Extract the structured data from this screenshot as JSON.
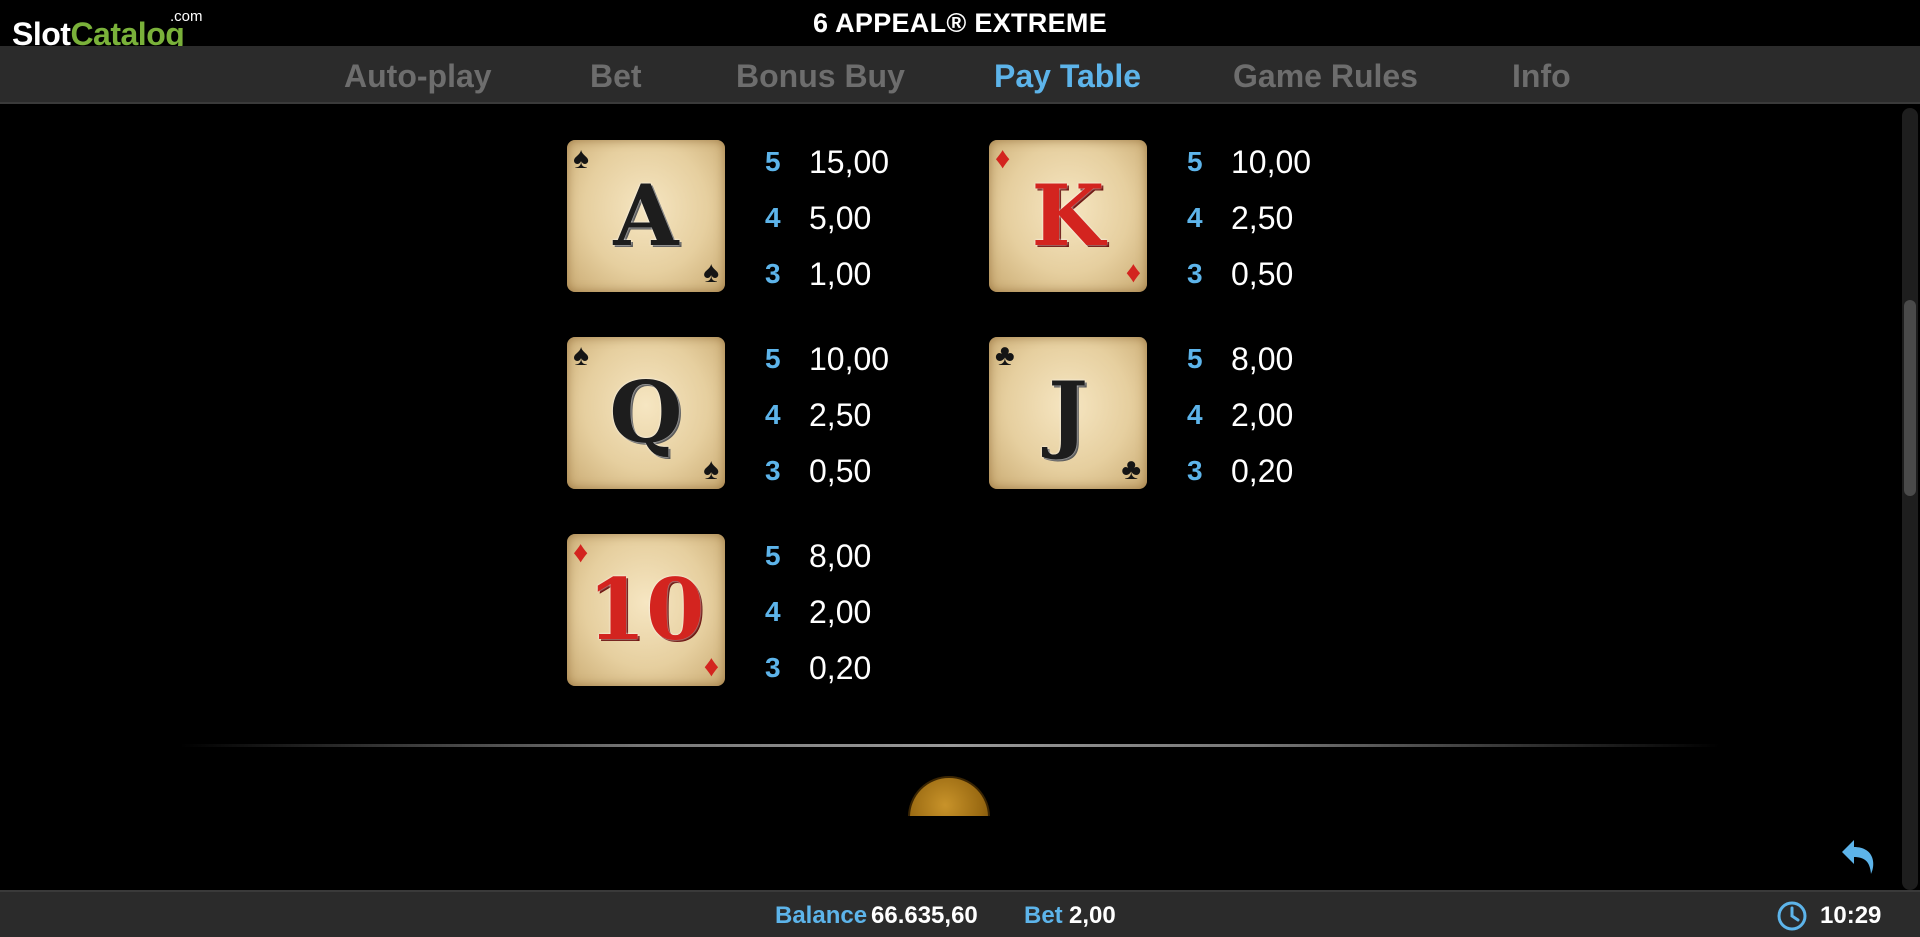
{
  "header": {
    "title": "6 APPEAL® EXTREME",
    "logo": {
      "slot": "Slot",
      "catalog": "Catalog",
      "com": ".com"
    }
  },
  "nav": {
    "tabs": [
      {
        "label": "Auto-play",
        "active": false
      },
      {
        "label": "Bet",
        "active": false
      },
      {
        "label": "Bonus Buy",
        "active": false
      },
      {
        "label": "Pay Table",
        "active": true
      },
      {
        "label": "Game Rules",
        "active": false
      },
      {
        "label": "Info",
        "active": false
      }
    ]
  },
  "paytable": {
    "symbols": [
      {
        "rank": "A",
        "suit": "♠",
        "suit_color": "black",
        "pays": [
          {
            "count": "5",
            "amount": "15,00"
          },
          {
            "count": "4",
            "amount": "5,00"
          },
          {
            "count": "3",
            "amount": "1,00"
          }
        ]
      },
      {
        "rank": "K",
        "suit": "♦",
        "suit_color": "red",
        "pays": [
          {
            "count": "5",
            "amount": "10,00"
          },
          {
            "count": "4",
            "amount": "2,50"
          },
          {
            "count": "3",
            "amount": "0,50"
          }
        ]
      },
      {
        "rank": "Q",
        "suit": "♠",
        "suit_color": "black",
        "pays": [
          {
            "count": "5",
            "amount": "10,00"
          },
          {
            "count": "4",
            "amount": "2,50"
          },
          {
            "count": "3",
            "amount": "0,50"
          }
        ]
      },
      {
        "rank": "J",
        "suit": "♣",
        "suit_color": "black",
        "pays": [
          {
            "count": "5",
            "amount": "8,00"
          },
          {
            "count": "4",
            "amount": "2,00"
          },
          {
            "count": "3",
            "amount": "0,20"
          }
        ]
      },
      {
        "rank": "10",
        "suit": "♦",
        "suit_color": "red",
        "pays": [
          {
            "count": "5",
            "amount": "8,00"
          },
          {
            "count": "4",
            "amount": "2,00"
          },
          {
            "count": "3",
            "amount": "0,20"
          }
        ]
      }
    ]
  },
  "footer": {
    "balance_label": "Balance",
    "balance_value": "66.635,60",
    "bet_label": "Bet",
    "bet_value": "2,00",
    "time": "10:29"
  },
  "colors": {
    "accent": "#5db4ea",
    "brand_green": "#7ab13a",
    "bar_bg": "#2b2b2b",
    "tab_inactive": "#6d6d6d",
    "card_red": "#d3241f"
  },
  "icons": {
    "back": "undo-arrow-icon",
    "clock": "clock-icon"
  }
}
